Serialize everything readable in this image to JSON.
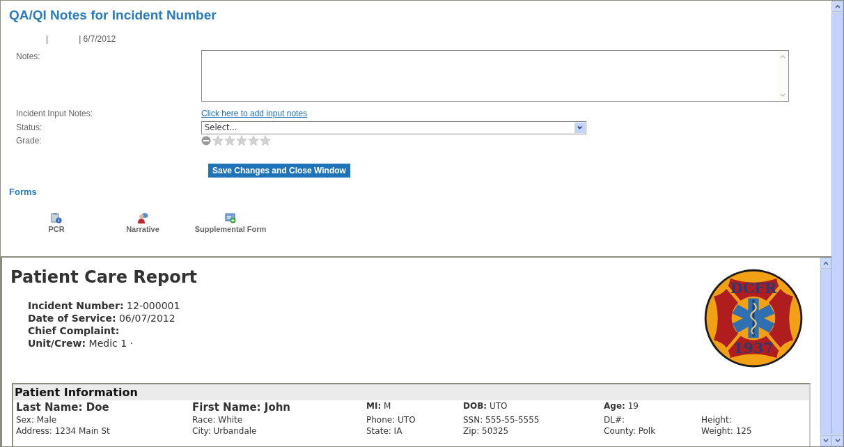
{
  "notes_panel": {
    "title": "QA/QI Notes for Incident Number",
    "meta": [
      "|",
      "| 6/7/2012"
    ],
    "fields": [
      {
        "kind": "textarea",
        "label": "Notes:"
      },
      {
        "kind": "link",
        "label": "Incident Input Notes:",
        "value": "Click here to add input notes"
      },
      {
        "kind": "select",
        "label": "Status:",
        "value": "Select..."
      },
      {
        "kind": "rating",
        "label": "Grade:",
        "stars": 0
      }
    ],
    "save_button": "Save Changes and Close Window",
    "forms_heading": "Forms",
    "forms": [
      {
        "kind": "clipboard",
        "label": "PCR"
      },
      {
        "kind": "narrative",
        "label": "Narrative"
      },
      {
        "kind": "supplemental",
        "label": "Supplemental Form"
      }
    ]
  },
  "report": {
    "title": "Patient Care Report",
    "details": [
      "**Incident Number:** 12-000001",
      "**Date of Service:** 06/07/2012",
      "**Chief Complaint:**",
      "**Unit/Crew:** Medic 1 ·"
    ],
    "logo": {
      "top_text": "DCFR",
      "bottom_text": "1937"
    },
    "patient_info": {
      "heading": "Patient Information",
      "rows": [
        [
          {
            "kind": "name",
            "label": "Last Name:",
            "value": "Doe"
          },
          {
            "kind": "name",
            "label": "First Name:",
            "value": "John"
          },
          {
            "kind": "key",
            "label": "MI:",
            "value": "M"
          },
          {
            "kind": "key",
            "label": "DOB:",
            "value": "UTO"
          },
          {
            "kind": "key",
            "label": "Age:",
            "value": "19"
          },
          {
            "kind": "blank"
          }
        ],
        [
          {
            "kind": "plain",
            "label": "Sex:",
            "value": "Male"
          },
          {
            "kind": "plain",
            "label": "Race:",
            "value": "White"
          },
          {
            "kind": "plain",
            "label": "Phone:",
            "value": "UTO"
          },
          {
            "kind": "plain",
            "label": "SSN:",
            "value": "555-55-5555"
          },
          {
            "kind": "plain",
            "label": "DL#:"
          },
          {
            "kind": "plain",
            "label": "Height:"
          }
        ],
        [
          {
            "kind": "plain",
            "label": "Address:",
            "value": "1234 Main St"
          },
          {
            "kind": "plain",
            "label": "City:",
            "value": "Urbandale"
          },
          {
            "kind": "plain",
            "label": "State:",
            "value": "IA"
          },
          {
            "kind": "plain",
            "label": "Zip:",
            "value": "50325"
          },
          {
            "kind": "plain",
            "label": "County:",
            "value": "Polk"
          },
          {
            "kind": "plain",
            "label": "Weight:",
            "value": "125"
          }
        ]
      ]
    }
  }
}
